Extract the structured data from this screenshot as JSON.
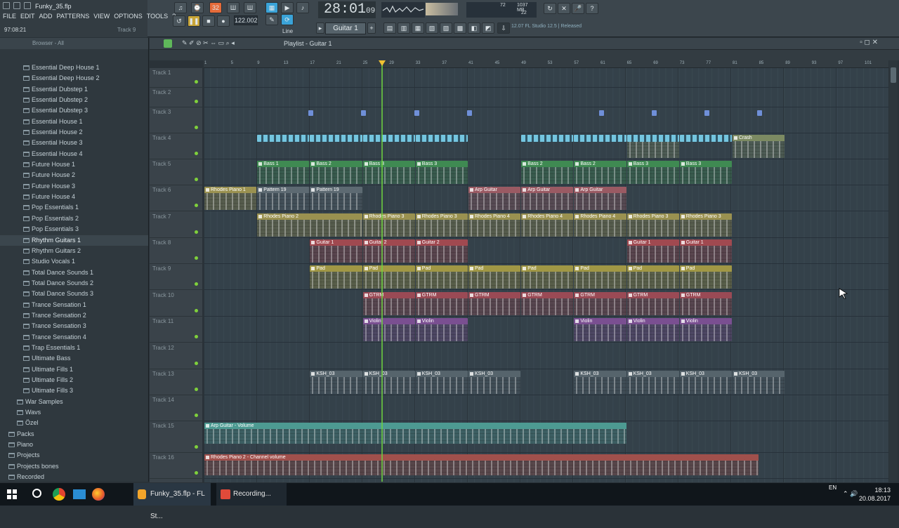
{
  "window": {
    "file_title": "Funky_35.flp",
    "position": "97:08:21",
    "focus_target": "Track 9"
  },
  "menu": [
    "FILE",
    "EDIT",
    "ADD",
    "PATTERNS",
    "VIEW",
    "OPTIONS",
    "TOOLS",
    "?"
  ],
  "transport": {
    "time": "28:01",
    "time_sub": "09",
    "tempo": "122.002",
    "pattern": "Guitar 1",
    "snap_mode": "Line",
    "pattern_counter": "32",
    "cpu": "72",
    "memory": "1037 MB",
    "polyphony": "22",
    "hint": "12.07  FL Studio 12.5 | Released"
  },
  "browser": {
    "header": "Browser - All",
    "items": [
      {
        "label": "Essential Deep House 1",
        "level": 2
      },
      {
        "label": "Essential Deep House 2",
        "level": 2
      },
      {
        "label": "Essential Dubstep 1",
        "level": 2
      },
      {
        "label": "Essential Dubstep 2",
        "level": 2
      },
      {
        "label": "Essential Dubstep 3",
        "level": 2
      },
      {
        "label": "Essential House 1",
        "level": 2
      },
      {
        "label": "Essential House 2",
        "level": 2
      },
      {
        "label": "Essential House 3",
        "level": 2
      },
      {
        "label": "Essential House 4",
        "level": 2
      },
      {
        "label": "Future House 1",
        "level": 2
      },
      {
        "label": "Future House 2",
        "level": 2
      },
      {
        "label": "Future House 3",
        "level": 2
      },
      {
        "label": "Future House 4",
        "level": 2
      },
      {
        "label": "Pop Essentials 1",
        "level": 2
      },
      {
        "label": "Pop Essentials 2",
        "level": 2
      },
      {
        "label": "Pop Essentials 3",
        "level": 2
      },
      {
        "label": "Rhythm Guitars 1",
        "level": 2,
        "selected": true
      },
      {
        "label": "Rhythm Guitars 2",
        "level": 2
      },
      {
        "label": "Studio Vocals 1",
        "level": 2
      },
      {
        "label": "Total Dance Sounds 1",
        "level": 2
      },
      {
        "label": "Total Dance Sounds 2",
        "level": 2
      },
      {
        "label": "Total Dance Sounds 3",
        "level": 2
      },
      {
        "label": "Trance Sensation 1",
        "level": 2
      },
      {
        "label": "Trance Sensation 2",
        "level": 2
      },
      {
        "label": "Trance Sensation 3",
        "level": 2
      },
      {
        "label": "Trance Sensation 4",
        "level": 2
      },
      {
        "label": "Trap Essentials 1",
        "level": 2
      },
      {
        "label": "Ultimate Bass",
        "level": 2
      },
      {
        "label": "Ultimate Fills 1",
        "level": 2
      },
      {
        "label": "Ultimate Fills 2",
        "level": 2
      },
      {
        "label": "Ultimate Fills 3",
        "level": 2
      },
      {
        "label": "War Samples",
        "level": 1
      },
      {
        "label": "Wavs",
        "level": 1
      },
      {
        "label": "Özel",
        "level": 1
      },
      {
        "label": "Packs",
        "level": 0
      },
      {
        "label": "Piano",
        "level": 0
      },
      {
        "label": "Projects",
        "level": 0
      },
      {
        "label": "Projects bones",
        "level": 0
      },
      {
        "label": "Recorded",
        "level": 0
      }
    ]
  },
  "playlist": {
    "title": "Playlist - Guitar 1",
    "ruler_ticks": [
      "1",
      "5",
      "9",
      "13",
      "17",
      "21",
      "25",
      "29",
      "33",
      "37",
      "41",
      "45",
      "49",
      "53",
      "57",
      "61",
      "65",
      "69",
      "73",
      "77",
      "81",
      "85",
      "89",
      "93",
      "97",
      "101"
    ],
    "tracks": [
      "Track 1",
      "Track 2",
      "Track 3",
      "Track 4",
      "Track 5",
      "Track 6",
      "Track 7",
      "Track 8",
      "Track 9",
      "Track 10",
      "Track 11",
      "Track 12",
      "Track 13",
      "Track 14",
      "Track 15",
      "Track 16"
    ],
    "clips": [
      {
        "track": 4,
        "bar": 65,
        "len": 8,
        "label": "Crash",
        "color": "#7c8a62"
      },
      {
        "track": 4,
        "bar": 81,
        "len": 8,
        "label": "Crash",
        "color": "#7c8a62"
      },
      {
        "track": 5,
        "bar": 9,
        "len": 8,
        "label": "Bass 1",
        "color": "#3f8a52"
      },
      {
        "track": 5,
        "bar": 17,
        "len": 8,
        "label": "Bass 2",
        "color": "#3f8a52"
      },
      {
        "track": 5,
        "bar": 25,
        "len": 8,
        "label": "Bass 3",
        "color": "#3f8a52"
      },
      {
        "track": 5,
        "bar": 33,
        "len": 8,
        "label": "Bass 3",
        "color": "#3f8a52"
      },
      {
        "track": 5,
        "bar": 49,
        "len": 8,
        "label": "Bass 2",
        "color": "#3f8a52"
      },
      {
        "track": 5,
        "bar": 57,
        "len": 8,
        "label": "Bass 2",
        "color": "#3f8a52"
      },
      {
        "track": 5,
        "bar": 65,
        "len": 8,
        "label": "Bass 3",
        "color": "#3f8a52"
      },
      {
        "track": 5,
        "bar": 73,
        "len": 8,
        "label": "Bass 3",
        "color": "#3f8a52"
      },
      {
        "track": 6,
        "bar": 1,
        "len": 8,
        "label": "Rhodes Piano 1",
        "color": "#9a9150"
      },
      {
        "track": 6,
        "bar": 9,
        "len": 8,
        "label": "Pattern 19",
        "color": "#5d6a72"
      },
      {
        "track": 6,
        "bar": 17,
        "len": 8,
        "label": "Pattern 19",
        "color": "#5d6a72"
      },
      {
        "track": 6,
        "bar": 41,
        "len": 8,
        "label": "Arp Guitar",
        "color": "#9a5a63"
      },
      {
        "track": 6,
        "bar": 49,
        "len": 8,
        "label": "Arp Guitar",
        "color": "#9a5a63"
      },
      {
        "track": 6,
        "bar": 57,
        "len": 8,
        "label": "Arp Guitar",
        "color": "#9a5a63"
      },
      {
        "track": 7,
        "bar": 9,
        "len": 16,
        "label": "Rhodes Piano 2",
        "color": "#9a9150"
      },
      {
        "track": 7,
        "bar": 25,
        "len": 8,
        "label": "Rhodes Piano 3",
        "color": "#9a9150"
      },
      {
        "track": 7,
        "bar": 33,
        "len": 8,
        "label": "Rhodes Piano 3",
        "color": "#9a9150"
      },
      {
        "track": 7,
        "bar": 41,
        "len": 8,
        "label": "Rhodes Piano 4",
        "color": "#9a9150"
      },
      {
        "track": 7,
        "bar": 49,
        "len": 8,
        "label": "Rhodes Piano 4",
        "color": "#9a9150"
      },
      {
        "track": 7,
        "bar": 57,
        "len": 8,
        "label": "Rhodes Piano 4",
        "color": "#9a9150"
      },
      {
        "track": 7,
        "bar": 65,
        "len": 8,
        "label": "Rhodes Piano 3",
        "color": "#9a9150"
      },
      {
        "track": 7,
        "bar": 73,
        "len": 8,
        "label": "Rhodes Piano 3",
        "color": "#9a9150"
      },
      {
        "track": 8,
        "bar": 17,
        "len": 8,
        "label": "Guitar 1",
        "color": "#a04950"
      },
      {
        "track": 8,
        "bar": 25,
        "len": 8,
        "label": "Guitar 2",
        "color": "#a04950"
      },
      {
        "track": 8,
        "bar": 33,
        "len": 8,
        "label": "Guitar 2",
        "color": "#a04950"
      },
      {
        "track": 8,
        "bar": 65,
        "len": 8,
        "label": "Guitar 1",
        "color": "#a04950"
      },
      {
        "track": 8,
        "bar": 73,
        "len": 8,
        "label": "Guitar 1",
        "color": "#a04950"
      },
      {
        "track": 9,
        "bar": 17,
        "len": 8,
        "label": "Pad",
        "color": "#a09745"
      },
      {
        "track": 9,
        "bar": 25,
        "len": 8,
        "label": "Pad",
        "color": "#a09745"
      },
      {
        "track": 9,
        "bar": 33,
        "len": 8,
        "label": "Pad",
        "color": "#a09745"
      },
      {
        "track": 9,
        "bar": 41,
        "len": 8,
        "label": "Pad",
        "color": "#a09745"
      },
      {
        "track": 9,
        "bar": 49,
        "len": 8,
        "label": "Pad",
        "color": "#a09745"
      },
      {
        "track": 9,
        "bar": 57,
        "len": 8,
        "label": "Pad",
        "color": "#a09745"
      },
      {
        "track": 9,
        "bar": 65,
        "len": 8,
        "label": "Pad",
        "color": "#a09745"
      },
      {
        "track": 9,
        "bar": 73,
        "len": 8,
        "label": "Pad",
        "color": "#a09745"
      },
      {
        "track": 10,
        "bar": 25,
        "len": 8,
        "label": "GTRM",
        "color": "#9a4a55"
      },
      {
        "track": 10,
        "bar": 33,
        "len": 8,
        "label": "GTRM",
        "color": "#9a4a55"
      },
      {
        "track": 10,
        "bar": 41,
        "len": 8,
        "label": "GTRM",
        "color": "#9a4a55"
      },
      {
        "track": 10,
        "bar": 49,
        "len": 8,
        "label": "GTRM",
        "color": "#9a4a55"
      },
      {
        "track": 10,
        "bar": 57,
        "len": 8,
        "label": "GTRM",
        "color": "#9a4a55"
      },
      {
        "track": 10,
        "bar": 65,
        "len": 8,
        "label": "GTRM",
        "color": "#9a4a55"
      },
      {
        "track": 10,
        "bar": 73,
        "len": 8,
        "label": "GTRM",
        "color": "#9a4a55"
      },
      {
        "track": 11,
        "bar": 25,
        "len": 8,
        "label": "Violin",
        "color": "#7a4f91"
      },
      {
        "track": 11,
        "bar": 33,
        "len": 8,
        "label": "Violin",
        "color": "#7a4f91"
      },
      {
        "track": 11,
        "bar": 57,
        "len": 8,
        "label": "Violin",
        "color": "#7a4f91"
      },
      {
        "track": 11,
        "bar": 65,
        "len": 8,
        "label": "Violin",
        "color": "#7a4f91"
      },
      {
        "track": 11,
        "bar": 73,
        "len": 8,
        "label": "Violin",
        "color": "#7a4f91"
      },
      {
        "track": 13,
        "bar": 17,
        "len": 8,
        "label": "KSH_03",
        "color": "#56646c"
      },
      {
        "track": 13,
        "bar": 25,
        "len": 8,
        "label": "KSH_03",
        "color": "#56646c"
      },
      {
        "track": 13,
        "bar": 33,
        "len": 8,
        "label": "KSH_03",
        "color": "#56646c"
      },
      {
        "track": 13,
        "bar": 41,
        "len": 8,
        "label": "KSH_03",
        "color": "#56646c"
      },
      {
        "track": 13,
        "bar": 57,
        "len": 8,
        "label": "KSH_03",
        "color": "#56646c"
      },
      {
        "track": 13,
        "bar": 65,
        "len": 8,
        "label": "KSH_03",
        "color": "#56646c"
      },
      {
        "track": 13,
        "bar": 73,
        "len": 8,
        "label": "KSH_03",
        "color": "#56646c"
      },
      {
        "track": 13,
        "bar": 81,
        "len": 8,
        "label": "KSH_03",
        "color": "#56646c"
      },
      {
        "track": 15,
        "bar": 1,
        "len": 64,
        "label": "Arp Guitar - Volume",
        "color": "#4d9a92"
      },
      {
        "track": 16,
        "bar": 1,
        "len": 84,
        "label": "Rhodes Piano 2 - Channel volume",
        "color": "#a0504c"
      }
    ]
  },
  "taskbar": {
    "items": [
      "Funky_35.flp - FL St...",
      "Recording..."
    ],
    "language": "EN",
    "time": "18:13",
    "date": "20.08.2017"
  }
}
